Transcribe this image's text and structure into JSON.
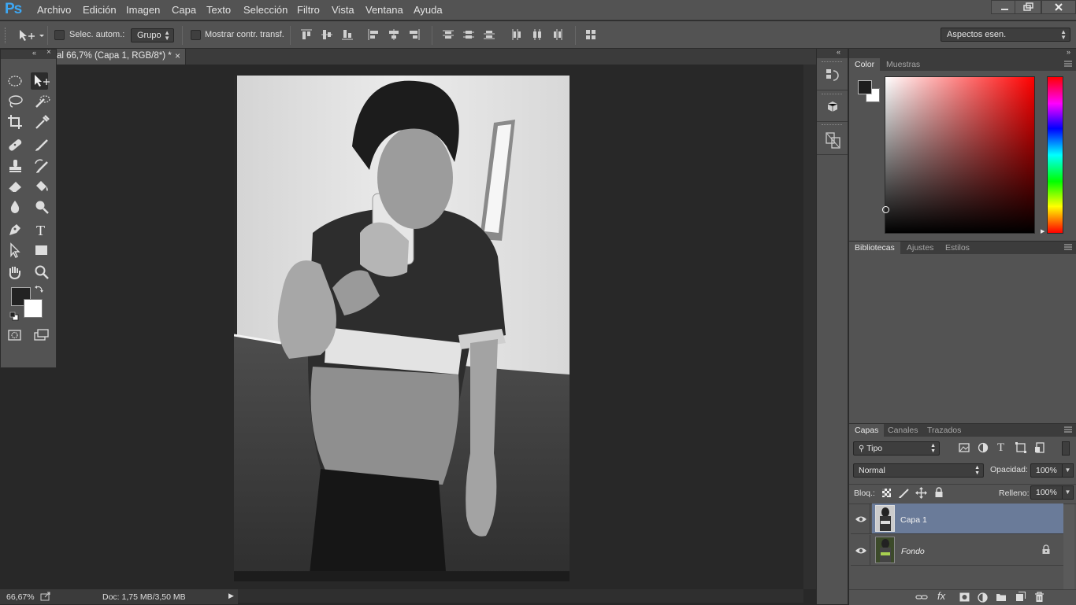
{
  "app": {
    "logo": "Ps"
  },
  "menu": [
    "Archivo",
    "Edición",
    "Imagen",
    "Capa",
    "Texto",
    "Selección",
    "Filtro",
    "Vista",
    "Ventana",
    "Ayuda"
  ],
  "options": {
    "auto_select_label": "Selec. autom.:",
    "auto_select_value": "Grupo",
    "show_transform_label": "Mostrar contr. transf.",
    "workspace": "Aspectos esen."
  },
  "document": {
    "tab_title": "al 66,7% (Capa 1, RGB/8*) *",
    "close": "×"
  },
  "status": {
    "zoom": "66,67%",
    "doc_info": "Doc: 1,75 MB/3,50 MB"
  },
  "color_panel": {
    "tabs": [
      "Color",
      "Muestras"
    ]
  },
  "libraries_panel": {
    "tabs": [
      "Bibliotecas",
      "Ajustes",
      "Estilos"
    ]
  },
  "layers_panel": {
    "tabs": [
      "Capas",
      "Canales",
      "Trazados"
    ],
    "filter_type": "Tipo",
    "blend_mode": "Normal",
    "opacity_label": "Opacidad:",
    "opacity_value": "100%",
    "lock_label": "Bloq.:",
    "fill_label": "Relleno:",
    "fill_value": "100%",
    "layers": [
      {
        "name": "Capa 1",
        "selected": true
      },
      {
        "name": "Fondo",
        "selected": false,
        "locked": true
      }
    ]
  },
  "colors": {
    "accent": "#3da8f5",
    "selected_layer": "#6a7b99",
    "panel": "#535353"
  }
}
